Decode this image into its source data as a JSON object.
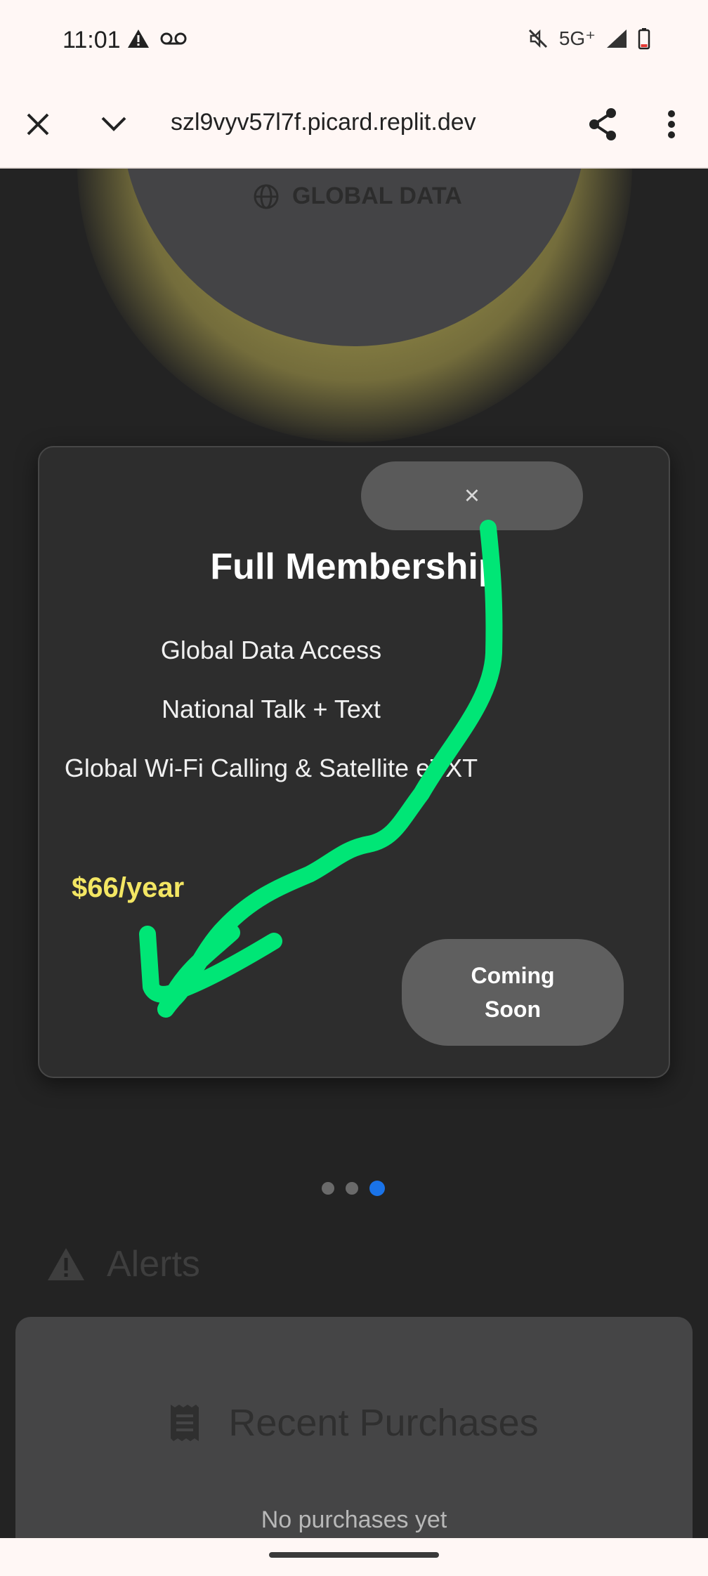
{
  "status_bar": {
    "time": "11:01",
    "network": "5G⁺",
    "icons": [
      "warning-icon",
      "voicemail-icon",
      "mute-icon",
      "signal-icon",
      "battery-icon"
    ]
  },
  "browser": {
    "url": "szl9vyv57l7f.picard.replit.dev",
    "icons": [
      "close-icon",
      "chevron-down-icon",
      "share-icon",
      "more-vert-icon"
    ]
  },
  "hero": {
    "label": "GLOBAL DATA",
    "icon": "globe-icon"
  },
  "modal": {
    "close_label": "×",
    "title": "Full Membership",
    "features": [
      "Global Data Access",
      "National Talk + Text",
      "Global Wi-Fi Calling & Satellite eTXT"
    ],
    "price": "$66/year",
    "cta_label": "Coming Soon"
  },
  "carousel": {
    "active_index": 2,
    "count": 3
  },
  "alerts": {
    "title": "Alerts",
    "icon": "warning-icon"
  },
  "purchases": {
    "title": "Recent Purchases",
    "icon": "receipt-icon",
    "empty_text": "No purchases yet"
  },
  "colors": {
    "accent_price": "#f3e663",
    "annotation": "#00e676",
    "dot_active": "#1a73e8"
  }
}
